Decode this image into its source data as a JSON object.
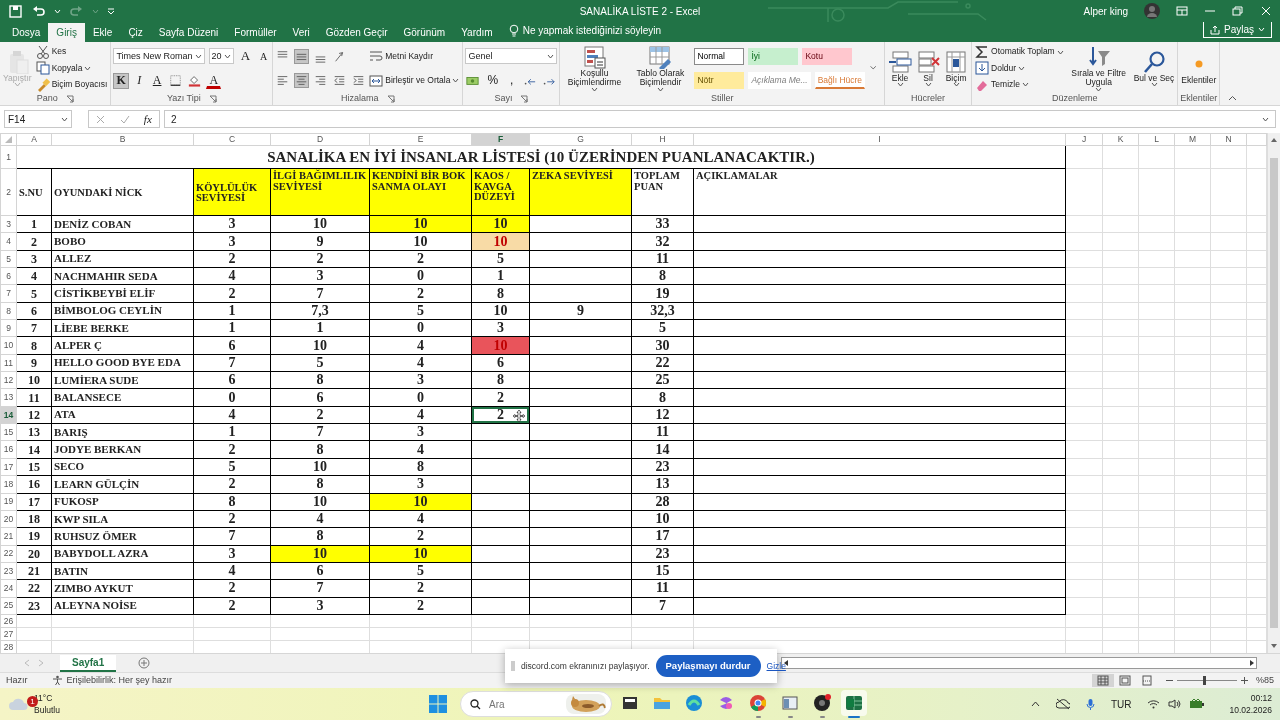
{
  "title_bar": {
    "quick_access": [
      {
        "disabled": false
      },
      {
        "disabled": false
      },
      {
        "disabled": true
      }
    ],
    "title": "SANALİKA LİSTE 2  -  Excel",
    "user": "Alper king"
  },
  "tabs": [
    {
      "label": "Dosya",
      "selected": false
    },
    {
      "label": "Giriş",
      "selected": true
    },
    {
      "label": "Ekle",
      "selected": false
    },
    {
      "label": "Çiz",
      "selected": false
    },
    {
      "label": "Sayfa Düzeni",
      "selected": false
    },
    {
      "label": "Formüller",
      "selected": false
    },
    {
      "label": "Veri",
      "selected": false
    },
    {
      "label": "Gözden Geçir",
      "selected": false
    },
    {
      "label": "Görünüm",
      "selected": false
    },
    {
      "label": "Yardım",
      "selected": false
    }
  ],
  "tell_me": "Ne yapmak istediğinizi söyleyin",
  "share_button": "Paylaş",
  "ribbon": [
    {
      "label": "Pano",
      "launcher": true,
      "stacks": [
        [
          [
            {
              "kind": "large",
              "label": "Yapıştır",
              "disabled": true,
              "menu": true
            }
          ]
        ],
        [
          [
            {
              "kind": "small",
              "label": "Kes",
              "menu": false
            }
          ],
          [
            {
              "kind": "small",
              "label": "Kopyala",
              "menu": true
            }
          ],
          [
            {
              "kind": "small",
              "label": "Biçim Boyacısı",
              "menu": false
            }
          ]
        ]
      ]
    },
    {
      "label": "Yazı Tipi",
      "launcher": true,
      "stacks": [
        [
          [
            {
              "kind": "field",
              "value": "Times New Roman"
            },
            {
              "kind": "field",
              "value": "20"
            },
            {
              "kind": "grow",
              "label": "A",
              "selected": false
            },
            {
              "kind": "shrink",
              "label": "A",
              "selected": false
            }
          ],
          [
            {
              "kind": "bold",
              "label": "K",
              "selected": true
            },
            {
              "kind": "italic",
              "label": "I",
              "selected": false
            },
            {
              "kind": "underline",
              "label": "A",
              "selected": false
            },
            {
              "kind": "icon",
              "selected": false
            },
            {
              "kind": "icon",
              "selected": false
            },
            {
              "kind": "fontcolor",
              "label": "A",
              "selected": false
            }
          ]
        ]
      ]
    },
    {
      "label": "Hizalama",
      "launcher": true,
      "stacks": [
        [
          [
            {
              "kind": "icon",
              "selected": false
            },
            {
              "kind": "icon",
              "selected": true
            },
            {
              "kind": "icon",
              "selected": false
            },
            {
              "kind": "icon",
              "selected": false
            }
          ],
          [
            {
              "kind": "icon",
              "selected": false
            },
            {
              "kind": "icon",
              "selected": true
            },
            {
              "kind": "icon",
              "selected": false
            },
            {
              "kind": "icon",
              "selected": false
            },
            {
              "kind": "icon",
              "selected": false
            }
          ]
        ],
        [
          [
            {
              "kind": "small",
              "label": "Metni Kaydır",
              "menu": false
            }
          ],
          [
            {
              "kind": "small",
              "label": "Birleştir ve Ortala",
              "menu": true
            }
          ]
        ]
      ]
    },
    {
      "label": "Sayı",
      "launcher": true,
      "stacks": [
        [
          [
            {
              "kind": "field",
              "value": "Genel"
            }
          ],
          [
            {
              "kind": "icon",
              "selected": false
            },
            {
              "kind": "symbol",
              "label": "%",
              "selected": false
            },
            {
              "kind": "symbol",
              "label": ",",
              "selected": false
            },
            {
              "kind": "icon",
              "selected": false
            },
            {
              "kind": "icon",
              "selected": false
            }
          ]
        ]
      ]
    },
    {
      "label": "Stiller",
      "launcher": false,
      "stacks": [
        [
          [
            {
              "kind": "large",
              "label": "Koşullu Biçimlendirme",
              "disabled": false,
              "menu": true
            }
          ]
        ],
        [
          [
            {
              "kind": "large",
              "label": "Tablo Olarak Biçimlendir",
              "disabled": false,
              "menu": true
            }
          ]
        ],
        [
          [
            {
              "kind": "style",
              "label": "Normal",
              "color": "#ffffff",
              "italic": false,
              "underline": false,
              "selected": true
            },
            {
              "kind": "style",
              "label": "İyi",
              "color": "#c6efce",
              "italic": false,
              "underline": false,
              "selected": false
            },
            {
              "kind": "style",
              "label": "Kotu",
              "color": "#ffc7ce",
              "italic": false,
              "underline": false,
              "selected": false
            }
          ],
          [
            {
              "kind": "style",
              "label": "Nötr",
              "color": "#ffeb9c",
              "italic": false,
              "underline": false,
              "selected": false
            },
            {
              "kind": "style",
              "label": "Açıklama Me...",
              "color": "#ffffff",
              "italic": true,
              "underline": false,
              "selected": false
            },
            {
              "kind": "style",
              "label": "Bağlı Hücre",
              "color": "#ffffff",
              "italic": false,
              "underline": true,
              "selected": false
            }
          ]
        ],
        [
          [
            {
              "kind": "icon",
              "selected": false
            }
          ]
        ]
      ]
    },
    {
      "label": "Hücreler",
      "launcher": false,
      "stacks": [
        [
          [
            {
              "kind": "large",
              "label": "Ekle",
              "disabled": false,
              "menu": true
            }
          ]
        ],
        [
          [
            {
              "kind": "large",
              "label": "Sil",
              "disabled": false,
              "menu": true
            }
          ]
        ],
        [
          [
            {
              "kind": "large",
              "label": "Biçim",
              "disabled": false,
              "menu": true
            }
          ]
        ]
      ]
    },
    {
      "label": "Düzenleme",
      "launcher": false,
      "stacks": [
        [
          [
            {
              "kind": "small",
              "label": "Otomatik Toplam",
              "menu": true
            }
          ],
          [
            {
              "kind": "small",
              "label": "Doldur",
              "menu": true
            }
          ],
          [
            {
              "kind": "small",
              "label": "Temizle",
              "menu": true
            }
          ]
        ],
        [
          [
            {
              "kind": "large",
              "label": "Sırala ve Filtre Uygula",
              "disabled": false,
              "menu": true
            }
          ]
        ],
        [
          [
            {
              "kind": "large",
              "label": "Bul ve Seç",
              "disabled": false,
              "menu": true
            }
          ]
        ]
      ]
    },
    {
      "label": "Eklentiler",
      "launcher": false,
      "stacks": [
        [
          [
            {
              "kind": "large",
              "label": "Eklentiler",
              "disabled": false,
              "menu": false
            }
          ]
        ]
      ]
    }
  ],
  "formula_bar": {
    "name_box": "F14",
    "function_label": "fx",
    "formula": "2"
  },
  "sheet": {
    "columns": [
      {
        "letter": "A",
        "selected": false
      },
      {
        "letter": "B",
        "selected": false
      },
      {
        "letter": "C",
        "selected": false
      },
      {
        "letter": "D",
        "selected": false
      },
      {
        "letter": "E",
        "selected": false
      },
      {
        "letter": "F",
        "selected": true
      },
      {
        "letter": "G",
        "selected": false
      },
      {
        "letter": "H",
        "selected": false
      },
      {
        "letter": "I",
        "selected": false
      },
      {
        "letter": "J",
        "selected": false
      },
      {
        "letter": "K",
        "selected": false
      },
      {
        "letter": "L",
        "selected": false
      },
      {
        "letter": "M",
        "selected": false
      },
      {
        "letter": "N",
        "selected": false
      }
    ],
    "row_headers": [
      {
        "label": "1",
        "selected": false
      },
      {
        "label": "2",
        "selected": false
      },
      {
        "label": "3",
        "selected": false
      },
      {
        "label": "4",
        "selected": false
      },
      {
        "label": "5",
        "selected": false
      },
      {
        "label": "6",
        "selected": false
      },
      {
        "label": "7",
        "selected": false
      },
      {
        "label": "8",
        "selected": false
      },
      {
        "label": "9",
        "selected": false
      },
      {
        "label": "10",
        "selected": false
      },
      {
        "label": "11",
        "selected": false
      },
      {
        "label": "12",
        "selected": false
      },
      {
        "label": "13",
        "selected": false
      },
      {
        "label": "14",
        "selected": true
      },
      {
        "label": "15",
        "selected": false
      },
      {
        "label": "16",
        "selected": false
      },
      {
        "label": "17",
        "selected": false
      },
      {
        "label": "18",
        "selected": false
      },
      {
        "label": "19",
        "selected": false
      },
      {
        "label": "20",
        "selected": false
      },
      {
        "label": "21",
        "selected": false
      },
      {
        "label": "22",
        "selected": false
      },
      {
        "label": "23",
        "selected": false
      },
      {
        "label": "24",
        "selected": false
      },
      {
        "label": "25",
        "selected": false
      },
      {
        "label": "26",
        "selected": false
      },
      {
        "label": "27",
        "selected": false
      },
      {
        "label": "28",
        "selected": false
      }
    ],
    "title": "SANALİKA EN İYİ İNSANLAR LİSTESİ  (10 ÜZERİNDEN PUANLANACAKTIR.)",
    "headers": [
      {
        "text": "S.NU",
        "highlighted": false
      },
      {
        "text": "OYUNDAKİ NİCK",
        "highlighted": false
      },
      {
        "text": "KÖYLÜLÜK SEVİYESİ",
        "highlighted": true
      },
      {
        "text": "İLGİ BAĞIMLILIK SEVİYESİ",
        "highlighted": true
      },
      {
        "text": "KENDİNİ BİR BOK SANMA OLAYI",
        "highlighted": true
      },
      {
        "text": "KAOS / KAVGA DÜZEYİ",
        "highlighted": true
      },
      {
        "text": "ZEKA SEVİYESİ",
        "highlighted": true
      },
      {
        "text": "TOPLAM PUAN",
        "highlighted": false
      },
      {
        "text": "AÇIKLAMALAR",
        "highlighted": false
      }
    ],
    "rows": [
      {
        "cells": [
          {
            "text": "1"
          },
          {
            "text": "DENİZ COBAN"
          },
          {
            "text": "3"
          },
          {
            "text": "10"
          },
          {
            "text": "10",
            "color": "#ffff00"
          },
          {
            "text": "10",
            "color": "#ffff00"
          },
          {},
          {
            "text": "33"
          }
        ]
      },
      {
        "cells": [
          {
            "text": "2"
          },
          {
            "text": "BOBO"
          },
          {
            "text": "3"
          },
          {
            "text": "9"
          },
          {
            "text": "10"
          },
          {
            "text": "10",
            "color": "#f8dba6",
            "alert": true
          },
          {},
          {
            "text": "32"
          }
        ]
      },
      {
        "cells": [
          {
            "text": "3"
          },
          {
            "text": "ALLEZ"
          },
          {
            "text": "2"
          },
          {
            "text": "2"
          },
          {
            "text": "2"
          },
          {
            "text": "5"
          },
          {},
          {
            "text": "11"
          }
        ]
      },
      {
        "cells": [
          {
            "text": "4"
          },
          {
            "text": "NACHMAHIR SEDA"
          },
          {
            "text": "4"
          },
          {
            "text": "3"
          },
          {
            "text": "0"
          },
          {
            "text": "1"
          },
          {},
          {
            "text": "8"
          }
        ]
      },
      {
        "cells": [
          {
            "text": "5"
          },
          {
            "text": "CİSTİKBEYBİ ELİF"
          },
          {
            "text": "2"
          },
          {
            "text": "7"
          },
          {
            "text": "2"
          },
          {
            "text": "8"
          },
          {},
          {
            "text": "19"
          }
        ]
      },
      {
        "cells": [
          {
            "text": "6"
          },
          {
            "text": "BİMBOLOG CEYLİN"
          },
          {
            "text": "1"
          },
          {
            "text": "7,3"
          },
          {
            "text": "5"
          },
          {
            "text": "10"
          },
          {
            "text": "9"
          },
          {
            "text": "32,3"
          }
        ]
      },
      {
        "cells": [
          {
            "text": "7"
          },
          {
            "text": "LİEBE BERKE"
          },
          {
            "text": "1"
          },
          {
            "text": "1"
          },
          {
            "text": "0"
          },
          {
            "text": "3"
          },
          {},
          {
            "text": "5"
          }
        ]
      },
      {
        "cells": [
          {
            "text": "8"
          },
          {
            "text": "ALPER Ç"
          },
          {
            "text": "6"
          },
          {
            "text": "10"
          },
          {
            "text": "4"
          },
          {
            "text": "10",
            "color": "#e9545b",
            "alert": true
          },
          {},
          {
            "text": "30"
          }
        ]
      },
      {
        "cells": [
          {
            "text": "9"
          },
          {
            "text": "HELLO GOOD BYE EDA"
          },
          {
            "text": "7"
          },
          {
            "text": "5"
          },
          {
            "text": "4"
          },
          {
            "text": "6"
          },
          {},
          {
            "text": "22"
          }
        ]
      },
      {
        "cells": [
          {
            "text": "10"
          },
          {
            "text": "LUMİERA SUDE"
          },
          {
            "text": "6"
          },
          {
            "text": "8"
          },
          {
            "text": "3"
          },
          {
            "text": "8"
          },
          {},
          {
            "text": "25"
          }
        ]
      },
      {
        "cells": [
          {
            "text": "11"
          },
          {
            "text": "BALANSECE"
          },
          {
            "text": "0"
          },
          {
            "text": "6"
          },
          {
            "text": "0"
          },
          {
            "text": "2"
          },
          {},
          {
            "text": "8"
          }
        ]
      },
      {
        "cells": [
          {
            "text": "12"
          },
          {
            "text": "ATA"
          },
          {
            "text": "4"
          },
          {
            "text": "2"
          },
          {
            "text": "4"
          },
          {
            "text": "2"
          },
          {},
          {
            "text": "12"
          }
        ]
      },
      {
        "cells": [
          {
            "text": "13"
          },
          {
            "text": "BARIŞ"
          },
          {
            "text": "1"
          },
          {
            "text": "7"
          },
          {
            "text": "3"
          },
          {},
          {},
          {
            "text": "11"
          }
        ]
      },
      {
        "cells": [
          {
            "text": "14"
          },
          {
            "text": "JODYE BERKAN"
          },
          {
            "text": "2"
          },
          {
            "text": "8"
          },
          {
            "text": "4"
          },
          {},
          {},
          {
            "text": "14"
          }
        ]
      },
      {
        "cells": [
          {
            "text": "15"
          },
          {
            "text": "SECO"
          },
          {
            "text": "5"
          },
          {
            "text": "10"
          },
          {
            "text": "8"
          },
          {},
          {},
          {
            "text": "23"
          }
        ]
      },
      {
        "cells": [
          {
            "text": "16"
          },
          {
            "text": "LEARN GÜLÇİN"
          },
          {
            "text": "2"
          },
          {
            "text": "8"
          },
          {
            "text": "3"
          },
          {},
          {},
          {
            "text": "13"
          }
        ]
      },
      {
        "cells": [
          {
            "text": "17"
          },
          {
            "text": "FUKOSP"
          },
          {
            "text": "8"
          },
          {
            "text": "10"
          },
          {
            "text": "10",
            "color": "#ffff00"
          },
          {},
          {},
          {
            "text": "28"
          }
        ]
      },
      {
        "cells": [
          {
            "text": "18"
          },
          {
            "text": "KWP SILA"
          },
          {
            "text": "2"
          },
          {
            "text": "4"
          },
          {
            "text": "4"
          },
          {},
          {},
          {
            "text": "10"
          }
        ]
      },
      {
        "cells": [
          {
            "text": "19"
          },
          {
            "text": "RUHSUZ ÖMER"
          },
          {
            "text": "7"
          },
          {
            "text": "8"
          },
          {
            "text": "2"
          },
          {},
          {},
          {
            "text": "17"
          }
        ]
      },
      {
        "cells": [
          {
            "text": "20"
          },
          {
            "text": "BABYDOLL AZRA"
          },
          {
            "text": "3"
          },
          {
            "text": "10",
            "color": "#ffff00"
          },
          {
            "text": "10",
            "color": "#ffff00"
          },
          {},
          {},
          {
            "text": "23"
          }
        ]
      },
      {
        "cells": [
          {
            "text": "21"
          },
          {
            "text": "BATIN"
          },
          {
            "text": "4"
          },
          {
            "text": "6"
          },
          {
            "text": "5"
          },
          {},
          {},
          {
            "text": "15"
          }
        ]
      },
      {
        "cells": [
          {
            "text": "22"
          },
          {
            "text": "ZIMBO AYKUT"
          },
          {
            "text": "2"
          },
          {
            "text": "7"
          },
          {
            "text": "2"
          },
          {},
          {},
          {
            "text": "11"
          }
        ]
      },
      {
        "cells": [
          {
            "text": "23"
          },
          {
            "text": "ALEYNA NOİSE"
          },
          {
            "text": "2"
          },
          {
            "text": "3"
          },
          {
            "text": "2"
          },
          {},
          {},
          {
            "text": "7"
          }
        ]
      }
    ]
  },
  "sheet_tabs": [
    {
      "label": "Sayfa1",
      "selected": true
    }
  ],
  "screen_share": {
    "message": "discord.com ekranınızı paylaşıyor.",
    "stop_button": "Paylaşmayı durdur",
    "hide_link": "Gizle"
  },
  "status_bar": {
    "status": "Hazır",
    "accessibility": "Erişilebilirlik: Her şey hazır",
    "views": [
      {
        "selected": true
      },
      {
        "selected": false
      },
      {
        "selected": false
      }
    ],
    "zoom_slider": {
      "level": 0.45
    },
    "zoom": "%85"
  },
  "taskbar": {
    "weather": {
      "badge": "1",
      "temperature": "11°C",
      "condition": "Bulutlu"
    },
    "search": {
      "placeholder": "Ara"
    },
    "apps": [
      {
        "running": false,
        "active": false
      },
      {
        "running": false,
        "active": false
      },
      {
        "running": false,
        "active": false
      },
      {
        "running": false,
        "active": false
      },
      {
        "running": true,
        "active": false
      },
      {
        "running": true,
        "active": false
      },
      {
        "running": true,
        "active": false
      },
      {
        "running": true,
        "active": true
      }
    ],
    "language": "TUR",
    "time": "00:12",
    "date": "10.02.2026"
  }
}
